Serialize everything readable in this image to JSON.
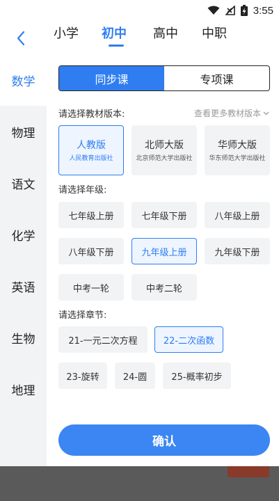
{
  "status": {
    "time": "3:55"
  },
  "levels": [
    {
      "label": "小学"
    },
    {
      "label": "初中"
    },
    {
      "label": "高中"
    },
    {
      "label": "中职"
    }
  ],
  "subjects": [
    {
      "label": "数学"
    },
    {
      "label": "物理"
    },
    {
      "label": "语文"
    },
    {
      "label": "化学"
    },
    {
      "label": "英语"
    },
    {
      "label": "生物"
    },
    {
      "label": "地理"
    }
  ],
  "mode_tabs": [
    {
      "label": "同步课"
    },
    {
      "label": "专项课"
    }
  ],
  "textbook": {
    "label": "请选择教材版本:",
    "more_link": "查看更多教材版本",
    "options": [
      {
        "name": "人教版",
        "publisher": "人民教育出版社"
      },
      {
        "name": "北师大版",
        "publisher": "北京师范大学出版社"
      },
      {
        "name": "华师大版",
        "publisher": "华东师范大学出版社"
      }
    ]
  },
  "grade": {
    "label": "请选择年级:",
    "options": [
      "七年级上册",
      "七年级下册",
      "八年级上册",
      "八年级下册",
      "九年级上册",
      "九年级下册",
      "中考一轮",
      "中考二轮"
    ]
  },
  "chapter": {
    "label": "请选择章节:",
    "options": [
      "21-一元二次方程",
      "22-二次函数",
      "23-旋转",
      "24-圆",
      "25-概率初步"
    ]
  },
  "confirm_label": "确认",
  "colors": {
    "accent": "#2F7DF0",
    "chip_bg": "#F2F3F5",
    "selected_bg": "#EEF5FF"
  }
}
